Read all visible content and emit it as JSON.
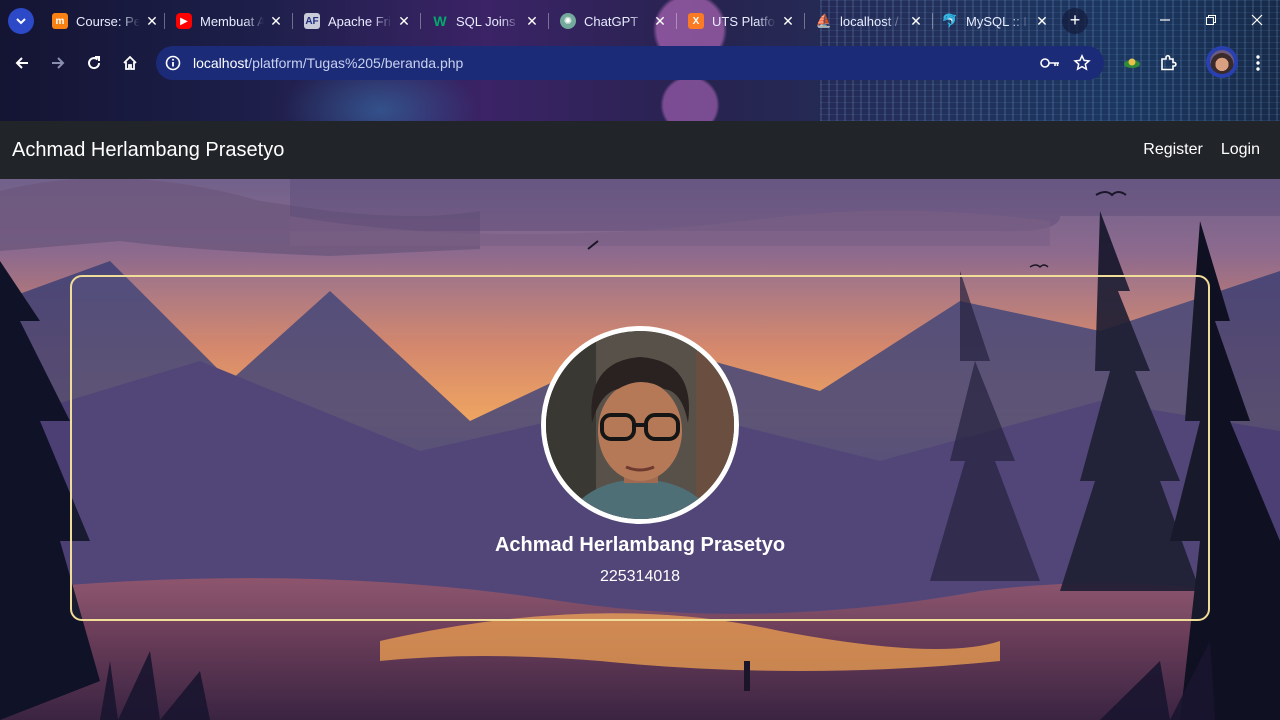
{
  "browser": {
    "tabs": [
      {
        "title": "Course: Pe",
        "favicon": "moodle-icon",
        "color": "#f98012"
      },
      {
        "title": "Membuat A",
        "favicon": "youtube-icon",
        "color": "#ff0000"
      },
      {
        "title": "Apache Fri",
        "favicon": "apache-friends-icon",
        "color": "#ffffff"
      },
      {
        "title": "SQL Joins",
        "favicon": "w3schools-icon",
        "color": "#04aa6d"
      },
      {
        "title": "ChatGPT",
        "favicon": "chatgpt-icon",
        "color": "#74aa9c"
      },
      {
        "title": "UTS Platfo",
        "favicon": "xampp-icon",
        "color": "#fb7a24"
      },
      {
        "title": "localhost /",
        "favicon": "phpmyadmin-icon",
        "color": "#f29111"
      },
      {
        "title": "MySQL :: I",
        "favicon": "mysql-icon",
        "color": "#00758f"
      }
    ],
    "new_tab": "+",
    "url_host": "localhost",
    "url_path": "/platform/Tugas%205/beranda.php"
  },
  "navbar": {
    "brand": "Achmad Herlambang Prasetyo",
    "register": "Register",
    "login": "Login"
  },
  "profile": {
    "name": "Achmad Herlambang Prasetyo",
    "nim": "225314018"
  },
  "colors": {
    "navbar_bg": "#212529",
    "card_border": "#f1dd9a",
    "omnibox_bg": "#1b2b78"
  }
}
